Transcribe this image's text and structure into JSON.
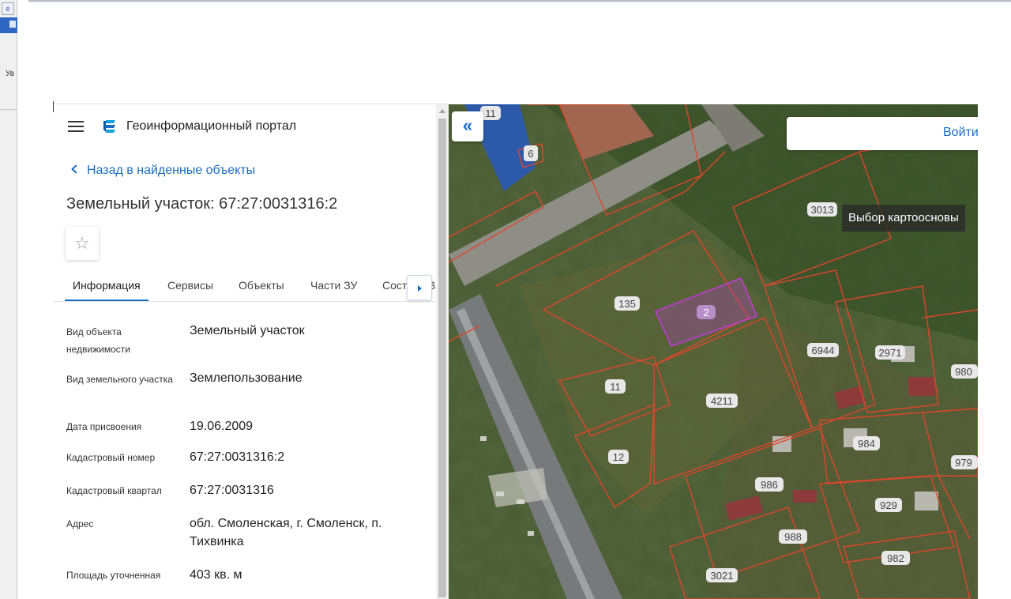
{
  "os": {
    "side_text": "Ув"
  },
  "panel": {
    "app_title": "Геоинформационный портал",
    "back_link": "Назад в найденные объекты",
    "page_title": "Земельный участок: 67:27:0031316:2",
    "favorite_icon": "star-icon",
    "tabs": [
      {
        "label": "Информация",
        "active": true
      },
      {
        "label": "Сервисы",
        "active": false
      },
      {
        "label": "Объекты",
        "active": false
      },
      {
        "label": "Части ЗУ",
        "active": false
      },
      {
        "label": "Сост",
        "active": false
      },
      {
        "label": "В",
        "active": false
      }
    ],
    "attributes": [
      {
        "label": "Вид объекта недвижимости",
        "value": "Земельный участок"
      },
      {
        "label": "Вид земельного участка",
        "value": "Землепользование"
      },
      {
        "label": "Дата присвоения",
        "value": "19.06.2009"
      },
      {
        "label": "Кадастровый номер",
        "value": "67:27:0031316:2"
      },
      {
        "label": "Кадастровый квартал",
        "value": "67:27:0031316"
      },
      {
        "label": "Адрес",
        "value": "обл. Смоленская, г. Смоленск, п. Тихвинка"
      },
      {
        "label": "Площадь уточненная",
        "value": "403 кв. м"
      }
    ]
  },
  "map": {
    "collapse_label": "«",
    "login_label": "Войти",
    "basemap_tooltip": "Выбор картоосновы",
    "parcel_color": "#e0462a",
    "selected_color": "#c03ad6",
    "parcel_labels": [
      "11",
      "6",
      "3013",
      "135",
      "2",
      "6944",
      "2971",
      "980",
      "11",
      "4211",
      "12",
      "984",
      "979",
      "986",
      "929",
      "988",
      "982",
      "3021"
    ]
  }
}
